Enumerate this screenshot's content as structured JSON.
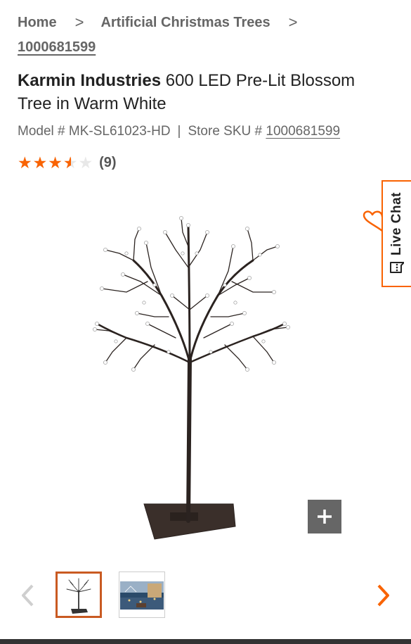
{
  "breadcrumb": {
    "home": "Home",
    "category": "Artificial Christmas Trees",
    "sku": "1000681599"
  },
  "product": {
    "brand": "Karmin Industries",
    "name": " 600 LED Pre-Lit Blossom Tree in Warm White",
    "model_label": "Model # MK-SL61023-HD",
    "sku_label": "Store SKU # ",
    "sku_value": "1000681599",
    "rating": 3.5,
    "rating_max": 5,
    "review_count": "(9)"
  },
  "live_chat": {
    "label": "Live Chat"
  },
  "colors": {
    "accent": "#f96302",
    "text": "#333333",
    "muted": "#666666"
  },
  "icons": {
    "breadcrumb_separator": "chevron-right-icon",
    "zoom": "plus-icon",
    "chat": "chat-bubble-icon",
    "prev": "chevron-left-icon",
    "next": "chevron-right-icon"
  }
}
